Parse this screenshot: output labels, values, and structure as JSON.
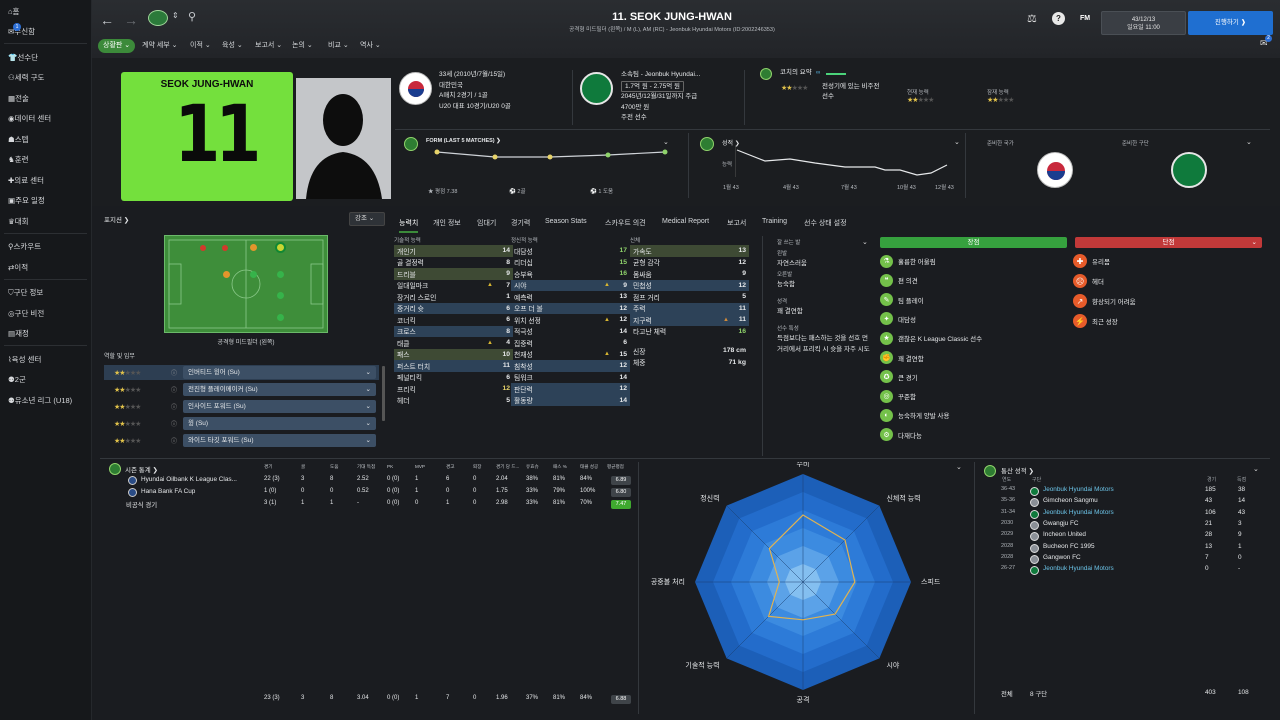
{
  "sidebar": {
    "items": [
      {
        "label": "홈",
        "icon": "home-icon"
      },
      {
        "label": "수신함",
        "icon": "inbox-icon",
        "badge": "1"
      },
      {
        "label": "선수단",
        "icon": "shirt-icon"
      },
      {
        "label": "세력 구도",
        "icon": "hierarchy-icon"
      },
      {
        "label": "전술",
        "icon": "tactics-icon"
      },
      {
        "label": "데이터 센터",
        "icon": "data-icon"
      },
      {
        "label": "스텝",
        "icon": "staff-icon"
      },
      {
        "label": "훈련",
        "icon": "training-icon"
      },
      {
        "label": "의료 센터",
        "icon": "medical-icon"
      },
      {
        "label": "주요 일정",
        "icon": "calendar-icon"
      },
      {
        "label": "대회",
        "icon": "trophy-icon"
      },
      {
        "label": "스카우트",
        "icon": "search-icon"
      },
      {
        "label": "이적",
        "icon": "transfer-icon"
      },
      {
        "label": "구단 정보",
        "icon": "shield-icon"
      },
      {
        "label": "구단 비전",
        "icon": "vision-icon"
      },
      {
        "label": "재정",
        "icon": "finance-icon"
      },
      {
        "label": "육성 센터",
        "icon": "development-icon"
      },
      {
        "label": "2군",
        "icon": "reserve-icon"
      },
      {
        "label": "유소년 리그 (U18)",
        "icon": "youth-icon"
      }
    ]
  },
  "header": {
    "player_name": "11. SEOK JUNG-HWAN",
    "subtitle": "공격형 미드필더 (왼쪽) / M (L), AM (RC) - Jeonbuk Hyundai Motors (ID:2002246353)",
    "date_line1": "43/12/13",
    "date_line2": "일요일 11:00",
    "continue": "진행하기",
    "fm": "FM",
    "notif_badge": "2"
  },
  "menu": [
    "상황판",
    "계약 세부",
    "이적",
    "육성",
    "보고서",
    "논의",
    "비교",
    "역사"
  ],
  "kit": {
    "name": "SEOK JUNG-HWAN",
    "number": "11"
  },
  "bio": {
    "age": "33세 (2010년/7월/15일)",
    "nation": "대한민국",
    "caps": "A매치 2경기 / 1골",
    "youth": "U20 대표 10경기/U20 0골"
  },
  "contract": {
    "club": "소속팀 - Jeonbuk Hyundai...",
    "value": "1.7억 원 - 2.75억 원",
    "until": "2045년/12월/31일까지 주급",
    "wage": "4700만 원",
    "status": "주전 선수"
  },
  "coach": {
    "title": "코치의 요약",
    "desc1": "전성기에 있는 비주전",
    "desc2": "선수",
    "current_label": "현재 능력",
    "potential_label": "잠재 능력",
    "current_stars": 2,
    "potential_stars": 2,
    "summary_stars": 2
  },
  "form": {
    "title": "FORM (LAST 5 MATCHES)",
    "rating": "평점 7.38",
    "goals": "2골",
    "assists": "1 도움"
  },
  "perf": {
    "title": "성적",
    "ylabel": "능력",
    "x": [
      "1월 43",
      "4월 43",
      "7월 43",
      "10월 43",
      "12월 43"
    ]
  },
  "fav": {
    "nation_label": "준비한 국가",
    "club_label": "준비한 구단"
  },
  "positions_label": "포지션",
  "strong_label": "강조",
  "pitch_caption": "공격형 미드필더 (왼쪽)",
  "roles_label": "역할 및 임무",
  "roles": [
    {
      "name": "인버티드 윙어 (Su)",
      "stars": 2
    },
    {
      "name": "전진형 플레이메이커 (Su)",
      "stars": 2
    },
    {
      "name": "인사이드 포워드 (Su)",
      "stars": 2
    },
    {
      "name": "윙 (Su)",
      "stars": 2
    },
    {
      "name": "와이드 타깃 포워드 (Su)",
      "stars": 2
    }
  ],
  "tabs": [
    "능력치",
    "개인 정보",
    "임대기",
    "경기력",
    "Season Stats",
    "스카우트 의견",
    "Medical Report",
    "보고서",
    "Training",
    "선수 상태 설정"
  ],
  "attributes": {
    "technical_label": "기술적 능력",
    "mental_label": "정신적 능력",
    "physical_label": "신체",
    "technical": [
      {
        "name": "개인기",
        "value": "14"
      },
      {
        "name": "골 결정력",
        "value": "8"
      },
      {
        "name": "드리블",
        "value": "9"
      },
      {
        "name": "퍼스트 터치(오타)",
        "value": ""
      }
    ],
    "technical_list": [
      [
        "개인기",
        "14",
        "hl2",
        ""
      ],
      [
        "골 결정력",
        "8",
        "",
        ""
      ],
      [
        "드리블",
        "9",
        "hl2",
        ""
      ],
      [
        "일대일마크",
        "7",
        "",
        "up"
      ],
      [
        "장거리 스로인",
        "1",
        "",
        ""
      ],
      [
        "중거리 슛",
        "6",
        "hl",
        ""
      ],
      [
        "코너킥",
        "6",
        "",
        ""
      ],
      [
        "크로스",
        "8",
        "hl",
        ""
      ],
      [
        "태클",
        "4",
        "",
        "up"
      ],
      [
        "패스",
        "10",
        "hl2",
        ""
      ],
      [
        "퍼스트 터치",
        "11",
        "hl",
        ""
      ],
      [
        "페널티킥",
        "6",
        "",
        ""
      ],
      [
        "프리킥",
        "12",
        "",
        "g"
      ],
      [
        "헤더",
        "5",
        "",
        ""
      ]
    ],
    "mental_list": [
      [
        "대담성",
        "17",
        "",
        "gg"
      ],
      [
        "리더십",
        "15",
        "",
        "gg"
      ],
      [
        "승부욕",
        "16",
        "",
        "gg"
      ],
      [
        "시야",
        "9",
        "hl",
        "up"
      ],
      [
        "예측력",
        "13",
        "",
        ""
      ],
      [
        "오프 더 볼",
        "12",
        "hl",
        ""
      ],
      [
        "위치 선정",
        "12",
        "",
        "up"
      ],
      [
        "적극성",
        "14",
        "",
        ""
      ],
      [
        "집중력",
        "6",
        "",
        ""
      ],
      [
        "천재성",
        "15",
        "",
        "up"
      ],
      [
        "침착성",
        "12",
        "hl",
        ""
      ],
      [
        "팀워크",
        "14",
        "",
        ""
      ],
      [
        "판단력",
        "12",
        "hl",
        ""
      ],
      [
        "활동량",
        "14",
        "hl",
        ""
      ]
    ],
    "physical_list": [
      [
        "가속도",
        "13",
        "hl2",
        ""
      ],
      [
        "균형 감각",
        "12",
        "",
        ""
      ],
      [
        "몸싸움",
        "9",
        "",
        ""
      ],
      [
        "민첩성",
        "12",
        "hl",
        ""
      ],
      [
        "점프 거리",
        "5",
        "",
        ""
      ],
      [
        "주력",
        "11",
        "hl",
        ""
      ],
      [
        "지구력",
        "11",
        "hl",
        "upo"
      ],
      [
        "타고난 체력",
        "16",
        "",
        "gg"
      ]
    ],
    "height_label": "신장",
    "height": "178 cm",
    "weight_label": "체중",
    "weight": "71 kg"
  },
  "traits_panel": {
    "foot_title": "잘 쓰는 발",
    "left_label": "왼발",
    "left_value": "자연스러움",
    "right_label": "오른발",
    "right_value": "능숙함",
    "personality_label": "성격",
    "personality": "꽤 결연함",
    "player_traits_label": "선수 특성",
    "player_traits": "득점보다는 패스하는 것을 선호 먼 거리에서 프리킥 시 슛을 자주 시도"
  },
  "strengths": {
    "label": "장점",
    "items": [
      "훌륭한 어울림",
      "편 의견",
      "팀 플레이",
      "대담성",
      "괜찮은 K League Classic 선수",
      "꽤 결연함",
      "큰 경기",
      "꾸준함",
      "능숙하게 양발 사용",
      "다재다능"
    ]
  },
  "weaknesses": {
    "label": "단점",
    "items": [
      "유리몸",
      "헤더",
      "향상되기 어려움",
      "최근 성장"
    ]
  },
  "season": {
    "title": "시즌 통계",
    "headers": [
      "경기",
      "골",
      "도움",
      "기대 득점",
      "PK",
      "MVP",
      "경고",
      "퇴장",
      "경기 당 드...",
      "유효슈",
      "패스 %",
      "태클 성공",
      "평균평점"
    ],
    "rows": [
      {
        "comp": "Hyundai Oilbank K League Clas...",
        "values": [
          "22 (3)",
          "3",
          "8",
          "2.52",
          "0 (0)",
          "1",
          "6",
          "0",
          "2.04",
          "38%",
          "81%",
          "84%"
        ],
        "rating": "6.89"
      },
      {
        "comp": "Hana Bank FA Cup",
        "values": [
          "1 (0)",
          "0",
          "0",
          "0.52",
          "0 (0)",
          "1",
          "0",
          "0",
          "1.75",
          "33%",
          "79%",
          "100%"
        ],
        "rating": "6.80"
      },
      {
        "comp": "비공식 경기",
        "values": [
          "3 (1)",
          "1",
          "1",
          "-",
          "0 (0)",
          "0",
          "1",
          "0",
          "2.98",
          "33%",
          "81%",
          "70%"
        ],
        "rating": "7.47"
      }
    ],
    "totals": [
      "23 (3)",
      "3",
      "8",
      "3.04",
      "0 (0)",
      "1",
      "7",
      "0",
      "1.96",
      "37%",
      "81%",
      "84%"
    ],
    "total_rating": "6.88"
  },
  "radar": {
    "labels": [
      "수비",
      "신체적 능력",
      "스피드",
      "시야",
      "공격",
      "기술적 능력",
      "공중볼 처리",
      "정신력"
    ],
    "values": [
      0.62,
      0.55,
      0.48,
      0.42,
      0.35,
      0.45,
      0.22,
      0.44
    ]
  },
  "history": {
    "title": "통산 성적",
    "col_year": "연도",
    "col_club": "구단",
    "col_apps": "경기",
    "col_goals": "득점",
    "rows": [
      {
        "year": "36-43",
        "club": "Jeonbuk Hyundai Motors",
        "apps": "185",
        "goals": "38",
        "link": true
      },
      {
        "year": "35-36",
        "club": "Gimcheon Sangmu",
        "apps": "43",
        "goals": "14",
        "link": false
      },
      {
        "year": "31-34",
        "club": "Jeonbuk Hyundai Motors",
        "apps": "106",
        "goals": "43",
        "link": true
      },
      {
        "year": "2030",
        "club": "Gwangju FC",
        "apps": "21",
        "goals": "3",
        "link": false
      },
      {
        "year": "2029",
        "club": "Incheon United",
        "apps": "28",
        "goals": "9",
        "link": false
      },
      {
        "year": "2028",
        "club": "Bucheon FC 1995",
        "apps": "13",
        "goals": "1",
        "link": false
      },
      {
        "year": "2028",
        "club": "Gangwon FC",
        "apps": "7",
        "goals": "0",
        "link": false
      },
      {
        "year": "26-27",
        "club": "Jeonbuk Hyundai Motors",
        "apps": "0",
        "goals": "-",
        "link": true
      }
    ],
    "total_label": "전체",
    "total_clubs": "8 구단",
    "total_apps": "403",
    "total_goals": "108"
  }
}
